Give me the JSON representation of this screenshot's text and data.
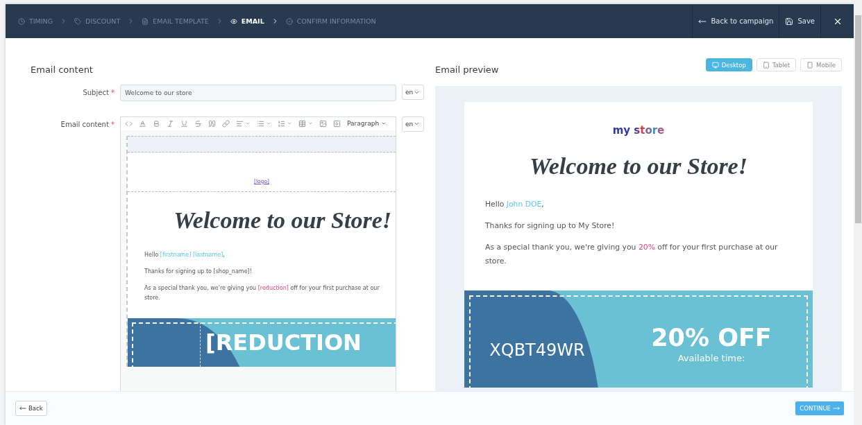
{
  "steps": [
    {
      "label": "TIMING",
      "selected": false
    },
    {
      "label": "DISCOUNT",
      "selected": false
    },
    {
      "label": "EMAIL TEMPLATE",
      "selected": false
    },
    {
      "label": "EMAIL",
      "selected": true
    },
    {
      "label": "CONFIRM INFORMATION",
      "selected": false
    }
  ],
  "header_actions": [
    {
      "label": "Back to campaign"
    },
    {
      "label": "Save"
    }
  ],
  "editor": {
    "title": "Email content",
    "subject": {
      "label": "Subject",
      "required_mark": "*",
      "value": "Welcome to our store",
      "language": "en"
    },
    "content": {
      "label": "Email content",
      "required_mark": "*",
      "language": "en",
      "format": "Paragraph",
      "logo_placeholder": "[logo]",
      "heading": "Welcome to our Store!",
      "paragraphs": [
        [
          {
            "kind": "text",
            "text": "Hello "
          },
          {
            "kind": "variable",
            "text": "[firstname] [lastname]"
          },
          {
            "kind": "text",
            "text": ","
          }
        ],
        [
          {
            "kind": "text",
            "text": "Thanks for signing up to [shop_name]!"
          }
        ],
        [
          {
            "kind": "text",
            "text": "As a special thank you, we're giving you "
          },
          {
            "kind": "highlight",
            "text": "[reduction]"
          },
          {
            "kind": "text",
            "text": " off for your first purchase at our store."
          }
        ]
      ],
      "coupon_text": "[REDUCTION"
    }
  },
  "preview": {
    "title": "Email preview",
    "devices": [
      {
        "label": "Desktop",
        "selected": true
      },
      {
        "label": "Tablet",
        "selected": false
      },
      {
        "label": "Mobile",
        "selected": false
      }
    ],
    "logo": "my store",
    "heading": "Welcome to our Store!",
    "paragraphs": [
      [
        {
          "kind": "text",
          "text": "Hello "
        },
        {
          "kind": "variable",
          "text": "John DOE"
        },
        {
          "kind": "text",
          "text": ","
        }
      ],
      [
        {
          "kind": "text",
          "text": "Thanks for signing up to My Store!"
        }
      ],
      [
        {
          "kind": "text",
          "text": "As a special thank you, we're giving you "
        },
        {
          "kind": "highlight",
          "text": "20%"
        },
        {
          "kind": "text",
          "text": " off for your first purchase at our store."
        }
      ]
    ],
    "coupon": {
      "code": "XQBT49WR",
      "discount": "20% OFF",
      "note": "Available time:"
    }
  },
  "footer": {
    "back": "Back",
    "continue": "CONTINUE"
  }
}
